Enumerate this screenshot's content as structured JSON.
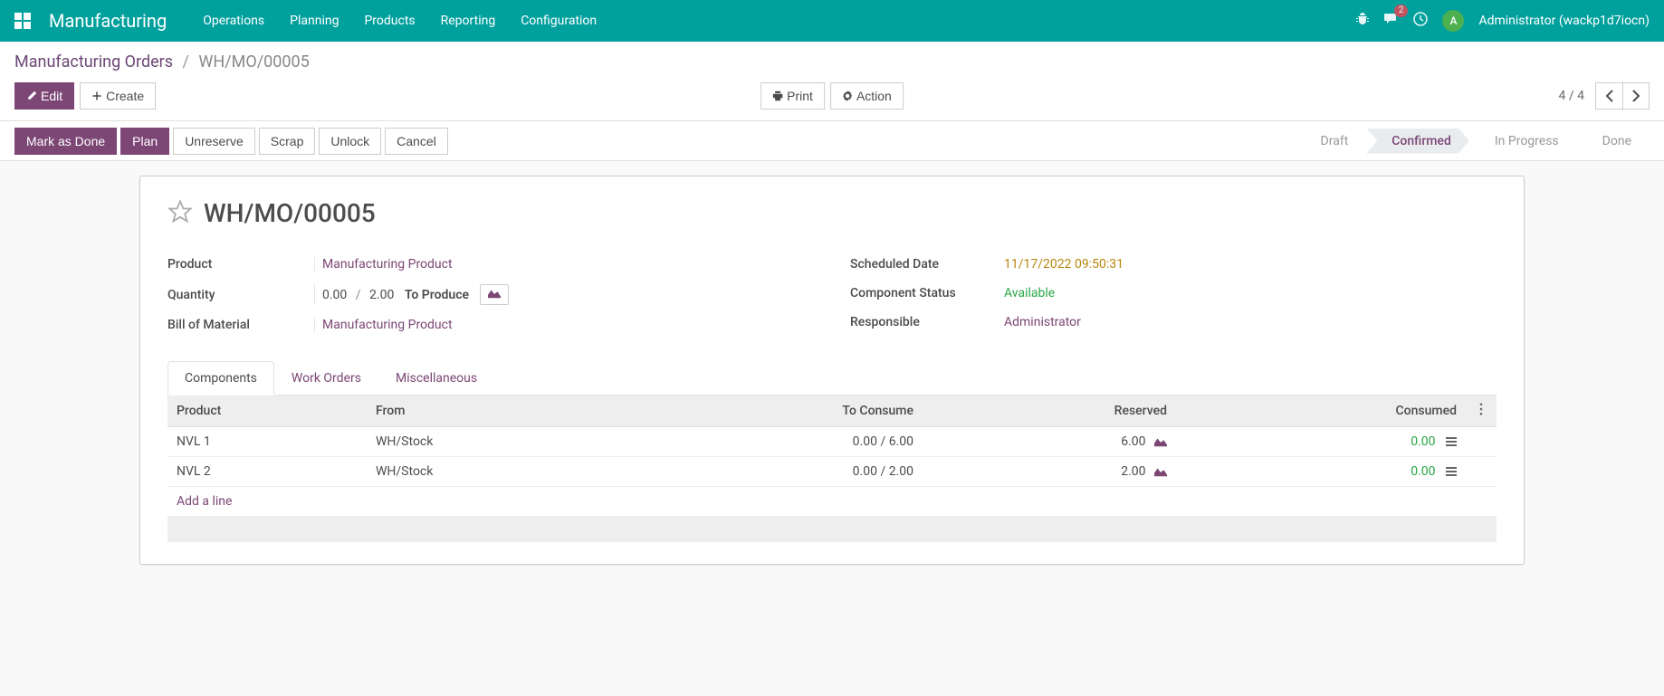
{
  "navbar": {
    "brand": "Manufacturing",
    "menu": [
      "Operations",
      "Planning",
      "Products",
      "Reporting",
      "Configuration"
    ],
    "msg_badge": "2",
    "avatar_letter": "A",
    "username": "Administrator (wackp1d7iocn)"
  },
  "breadcrumb": {
    "root": "Manufacturing Orders",
    "current": "WH/MO/00005"
  },
  "controls": {
    "edit": "Edit",
    "create": "Create",
    "print": "Print",
    "action": "Action",
    "pager": "4 / 4"
  },
  "statusbar": {
    "buttons": [
      "Mark as Done",
      "Plan",
      "Unreserve",
      "Scrap",
      "Unlock",
      "Cancel"
    ],
    "steps": [
      "Draft",
      "Confirmed",
      "In Progress",
      "Done"
    ],
    "active_step": 1
  },
  "record": {
    "title": "WH/MO/00005",
    "fields": {
      "product_label": "Product",
      "product_value": "Manufacturing Product",
      "quantity_label": "Quantity",
      "qty_done": "0.00",
      "qty_total": "2.00",
      "to_produce": "To Produce",
      "bom_label": "Bill of Material",
      "bom_value": "Manufacturing Product",
      "sched_label": "Scheduled Date",
      "sched_value": "11/17/2022 09:50:31",
      "comp_status_label": "Component Status",
      "comp_status_value": "Available",
      "resp_label": "Responsible",
      "resp_value": "Administrator"
    }
  },
  "tabs": [
    "Components",
    "Work Orders",
    "Miscellaneous"
  ],
  "table": {
    "headers": {
      "product": "Product",
      "from": "From",
      "to_consume": "To Consume",
      "reserved": "Reserved",
      "consumed": "Consumed"
    },
    "rows": [
      {
        "product": "NVL 1",
        "from": "WH/Stock",
        "consume_done": "0.00",
        "consume_total": "6.00",
        "reserved": "6.00",
        "consumed": "0.00"
      },
      {
        "product": "NVL 2",
        "from": "WH/Stock",
        "consume_done": "0.00",
        "consume_total": "2.00",
        "reserved": "2.00",
        "consumed": "0.00"
      }
    ],
    "add_line": "Add a line"
  }
}
